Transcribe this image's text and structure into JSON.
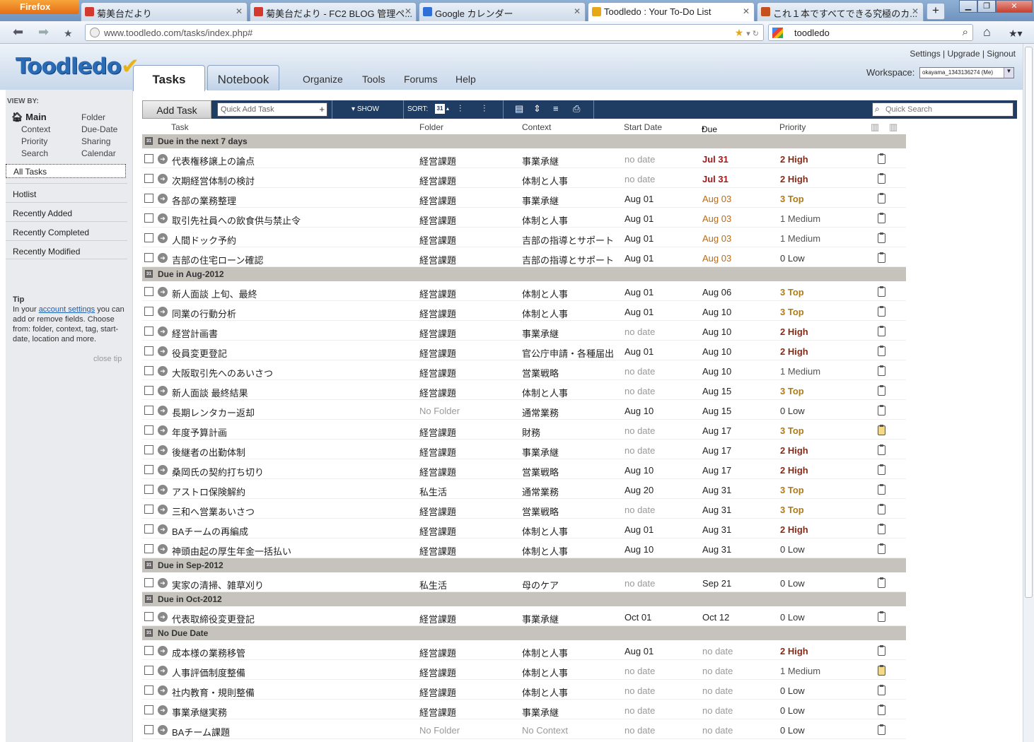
{
  "browser": {
    "menu_button": "Firefox",
    "tabs": [
      {
        "title": "菊美台だより",
        "color": "#d23a2f"
      },
      {
        "title": "菊美台だより - FC2 BLOG 管理ペ...",
        "color": "#d23a2f"
      },
      {
        "title": "Google カレンダー",
        "color": "#2f6fd6"
      },
      {
        "title": "Toodledo : Your To-Do List",
        "color": "#e6a817"
      },
      {
        "title": "これ１本ですべてできる究極のカ...",
        "color": "#c4501e"
      }
    ],
    "url": "www.toodledo.com/tasks/index.php#",
    "search_value": "toodledo"
  },
  "app": {
    "logo": "Toodledo",
    "top_links": "Settings | Upgrade | Signout",
    "workspace_label": "Workspace:",
    "workspace_value": "okayama_1343136274 (Me)",
    "tabs": {
      "tasks": "Tasks",
      "notebook": "Notebook"
    },
    "nav": {
      "organize": "Organize",
      "tools": "Tools",
      "forums": "Forums",
      "help": "Help"
    }
  },
  "sidebar": {
    "view_by": "VIEW BY:",
    "left_col": [
      "Main",
      "Context",
      "Priority",
      "Search"
    ],
    "right_col": [
      "Folder",
      "Due-Date",
      "Sharing",
      "Calendar"
    ],
    "lists": [
      "All Tasks",
      "Hotlist",
      "Recently Added",
      "Recently Completed",
      "Recently Modified"
    ],
    "tip_title": "Tip",
    "tip_pre": "In your ",
    "tip_link": "account settings",
    "tip_post": " you can add or remove fields. Choose from: folder, context, tag, start-date, location and more.",
    "close_tip": "close tip"
  },
  "toolbar": {
    "add_task": "Add Task",
    "quick_add_placeholder": "Quick Add Task",
    "show": "SHOW",
    "sort": "SORT:",
    "quick_search_placeholder": "Quick Search"
  },
  "columns": {
    "task": "Task",
    "folder": "Folder",
    "context": "Context",
    "start": "Start Date",
    "due": "Due Date",
    "priority": "Priority"
  },
  "groups": [
    {
      "title": "Due in the next 7 days",
      "rows": [
        {
          "task": "代表権移譲上の論点",
          "folder": "経営課題",
          "context": "事業承継",
          "start": "no date",
          "due": "Jul 31",
          "due_style": "red",
          "priority": "2 High",
          "note": false
        },
        {
          "task": "次期経営体制の検討",
          "folder": "経営課題",
          "context": "体制と人事",
          "start": "no date",
          "due": "Jul 31",
          "due_style": "red",
          "priority": "2 High",
          "note": false
        },
        {
          "task": "各部の業務整理",
          "folder": "経営課題",
          "context": "事業承継",
          "start": "Aug 01",
          "due": "Aug 03",
          "due_style": "orange",
          "priority": "3 Top",
          "note": false
        },
        {
          "task": "取引先社員への飲食供与禁止令",
          "folder": "経営課題",
          "context": "体制と人事",
          "start": "Aug 01",
          "due": "Aug 03",
          "due_style": "orange",
          "priority": "1 Medium",
          "note": false
        },
        {
          "task": "人間ドック予約",
          "folder": "経営課題",
          "context": "吉部の指導とサポート",
          "start": "Aug 01",
          "due": "Aug 03",
          "due_style": "orange",
          "priority": "1 Medium",
          "note": false
        },
        {
          "task": "吉部の住宅ローン確認",
          "folder": "経営課題",
          "context": "吉部の指導とサポート",
          "start": "Aug 01",
          "due": "Aug 03",
          "due_style": "orange",
          "priority": "0 Low",
          "note": false
        }
      ]
    },
    {
      "title": "Due in Aug-2012",
      "rows": [
        {
          "task": "新人面談 上旬、最終",
          "folder": "経営課題",
          "context": "体制と人事",
          "start": "Aug 01",
          "due": "Aug 06",
          "due_style": "",
          "priority": "3 Top",
          "note": false
        },
        {
          "task": "同業の行動分析",
          "folder": "経営課題",
          "context": "体制と人事",
          "start": "Aug 01",
          "due": "Aug 10",
          "due_style": "",
          "priority": "3 Top",
          "note": false
        },
        {
          "task": "経営計画書",
          "folder": "経営課題",
          "context": "事業承継",
          "start": "no date",
          "due": "Aug 10",
          "due_style": "",
          "priority": "2 High",
          "note": false
        },
        {
          "task": "役員変更登記",
          "folder": "経営課題",
          "context": "官公庁申請・各種届出",
          "start": "Aug 01",
          "due": "Aug 10",
          "due_style": "",
          "priority": "2 High",
          "note": false
        },
        {
          "task": "大阪取引先へのあいさつ",
          "folder": "経営課題",
          "context": "営業戦略",
          "start": "no date",
          "due": "Aug 10",
          "due_style": "",
          "priority": "1 Medium",
          "note": false
        },
        {
          "task": "新人面談 最終結果",
          "folder": "経営課題",
          "context": "体制と人事",
          "start": "no date",
          "due": "Aug 15",
          "due_style": "",
          "priority": "3 Top",
          "note": false
        },
        {
          "task": "長期レンタカー返却",
          "folder": "No Folder",
          "context": "通常業務",
          "start": "Aug 10",
          "due": "Aug 15",
          "due_style": "",
          "priority": "0 Low",
          "note": false
        },
        {
          "task": "年度予算計画",
          "folder": "経営課題",
          "context": "財務",
          "start": "no date",
          "due": "Aug 17",
          "due_style": "",
          "priority": "3 Top",
          "note": true
        },
        {
          "task": "後継者の出勤体制",
          "folder": "経営課題",
          "context": "事業承継",
          "start": "no date",
          "due": "Aug 17",
          "due_style": "",
          "priority": "2 High",
          "note": false
        },
        {
          "task": "桑岡氏の契約打ち切り",
          "folder": "経営課題",
          "context": "営業戦略",
          "start": "Aug 10",
          "due": "Aug 17",
          "due_style": "",
          "priority": "2 High",
          "note": false
        },
        {
          "task": "アストロ保険解約",
          "folder": "私生活",
          "context": "通常業務",
          "start": "Aug 20",
          "due": "Aug 31",
          "due_style": "",
          "priority": "3 Top",
          "note": false
        },
        {
          "task": "三和へ営業あいさつ",
          "folder": "経営課題",
          "context": "営業戦略",
          "start": "no date",
          "due": "Aug 31",
          "due_style": "",
          "priority": "3 Top",
          "note": false
        },
        {
          "task": "BAチームの再編成",
          "folder": "経営課題",
          "context": "体制と人事",
          "start": "Aug 01",
          "due": "Aug 31",
          "due_style": "",
          "priority": "2 High",
          "note": false
        },
        {
          "task": "神頭由起の厚生年金一括払い",
          "folder": "経営課題",
          "context": "体制と人事",
          "start": "Aug 10",
          "due": "Aug 31",
          "due_style": "",
          "priority": "0 Low",
          "note": false
        }
      ]
    },
    {
      "title": "Due in Sep-2012",
      "rows": [
        {
          "task": "実家の清掃、雑草刈り",
          "folder": "私生活",
          "context": "母のケア",
          "start": "no date",
          "due": "Sep 21",
          "due_style": "",
          "priority": "0 Low",
          "note": false
        }
      ]
    },
    {
      "title": "Due in Oct-2012",
      "rows": [
        {
          "task": "代表取締役変更登記",
          "folder": "経営課題",
          "context": "事業承継",
          "start": "Oct 01",
          "due": "Oct 12",
          "due_style": "",
          "priority": "0 Low",
          "note": false
        }
      ]
    },
    {
      "title": "No Due Date",
      "rows": [
        {
          "task": "成本様の業務移管",
          "folder": "経営課題",
          "context": "体制と人事",
          "start": "Aug 01",
          "due": "no date",
          "due_style": "gray",
          "priority": "2 High",
          "note": false
        },
        {
          "task": "人事評価制度整備",
          "folder": "経営課題",
          "context": "体制と人事",
          "start": "no date",
          "due": "no date",
          "due_style": "gray",
          "priority": "1 Medium",
          "note": true
        },
        {
          "task": "社内教育・規則整備",
          "folder": "経営課題",
          "context": "体制と人事",
          "start": "no date",
          "due": "no date",
          "due_style": "gray",
          "priority": "0 Low",
          "note": false
        },
        {
          "task": "事業承継実務",
          "folder": "経営課題",
          "context": "事業承継",
          "start": "no date",
          "due": "no date",
          "due_style": "gray",
          "priority": "0 Low",
          "note": false
        },
        {
          "task": "BAチーム課題",
          "folder": "No Folder",
          "context": "No Context",
          "start": "no date",
          "due": "no date",
          "due_style": "gray",
          "priority": "0 Low",
          "note": false
        }
      ]
    }
  ]
}
